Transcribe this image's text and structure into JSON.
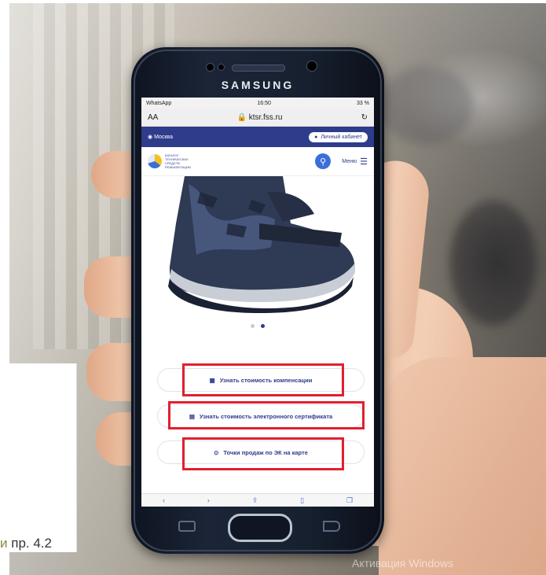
{
  "phone": {
    "brand": "SAMSUNG",
    "status": {
      "left": "WhatsApp",
      "time": "16:50",
      "battery": "33 %"
    },
    "url": {
      "aa": "AA",
      "address": "ktsr.fss.ru",
      "reload": "↻"
    },
    "topbar": {
      "region": "Москва",
      "cabinet": "Личный кабинет"
    },
    "header": {
      "logo_text": "КАТАЛОГ ТЕХНИЧЕСКИХ СРЕДСТВ РЕАБИЛИТАЦИИ",
      "menu": "Меню"
    },
    "actions": [
      {
        "label": "Узнать стоимость компенсации",
        "icon": "calculator-icon"
      },
      {
        "label": "Узнать стоимость электронного сертификата",
        "icon": "certificate-icon"
      },
      {
        "label": "Точки продаж по ЭК на карте",
        "icon": "map-pin-icon"
      }
    ],
    "highlight_color": "#e0202e",
    "accent": "#2e3c8c"
  },
  "caption": {
    "text": "пр. 4.2"
  },
  "watermark": {
    "text": "Активация Windows"
  }
}
